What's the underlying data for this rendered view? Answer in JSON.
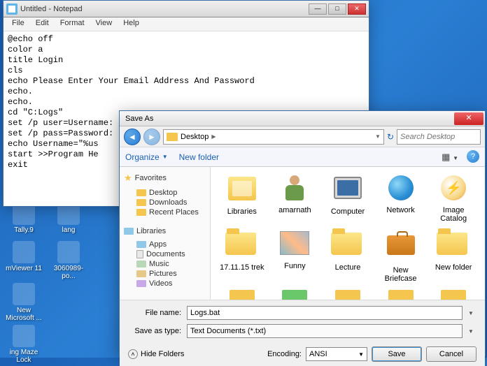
{
  "desktop": {
    "icons": [
      "Tally.9",
      "lang",
      "",
      "mViewer 11",
      "3060989-po...",
      "",
      "New Microsoft ...",
      "",
      "ing Maze Lock"
    ]
  },
  "notepad": {
    "title": "Untitled - Notepad",
    "menu": [
      "File",
      "Edit",
      "Format",
      "View",
      "Help"
    ],
    "content": "@echo off\ncolor a\ntitle Login\ncls\necho Please Enter Your Email Address And Password\necho.\necho.\ncd \"C:Logs\"\nset /p user=Username:\nset /p pass=Password:\necho Username=\"%us\nstart >>Program He\nexit"
  },
  "saveas": {
    "title": "Save As",
    "breadcrumb": "Desktop",
    "search_placeholder": "Search Desktop",
    "toolbar": {
      "organize": "Organize",
      "newfolder": "New folder"
    },
    "sidebar": {
      "favorites": "Favorites",
      "fav_items": [
        "Desktop",
        "Downloads",
        "Recent Places"
      ],
      "libraries": "Libraries",
      "lib_items": [
        "Apps",
        "Documents",
        "Music",
        "Pictures",
        "Videos"
      ]
    },
    "files": [
      {
        "name": "Libraries",
        "type": "libraries"
      },
      {
        "name": "amarnath",
        "type": "human"
      },
      {
        "name": "Computer",
        "type": "computer"
      },
      {
        "name": "Network",
        "type": "network"
      },
      {
        "name": "Image Catalog",
        "type": "catalog"
      },
      {
        "name": "17.11.15 trek",
        "type": "folder"
      },
      {
        "name": "Funny",
        "type": "pic"
      },
      {
        "name": "Lecture",
        "type": "folder"
      },
      {
        "name": "New Briefcase",
        "type": "briefcase"
      },
      {
        "name": "New folder",
        "type": "folder"
      }
    ],
    "filename_label": "File name:",
    "filename_value": "Logs.bat",
    "savetype_label": "Save as type:",
    "savetype_value": "Text Documents (*.txt)",
    "hide_folders": "Hide Folders",
    "encoding_label": "Encoding:",
    "encoding_value": "ANSI",
    "save": "Save",
    "cancel": "Cancel"
  }
}
